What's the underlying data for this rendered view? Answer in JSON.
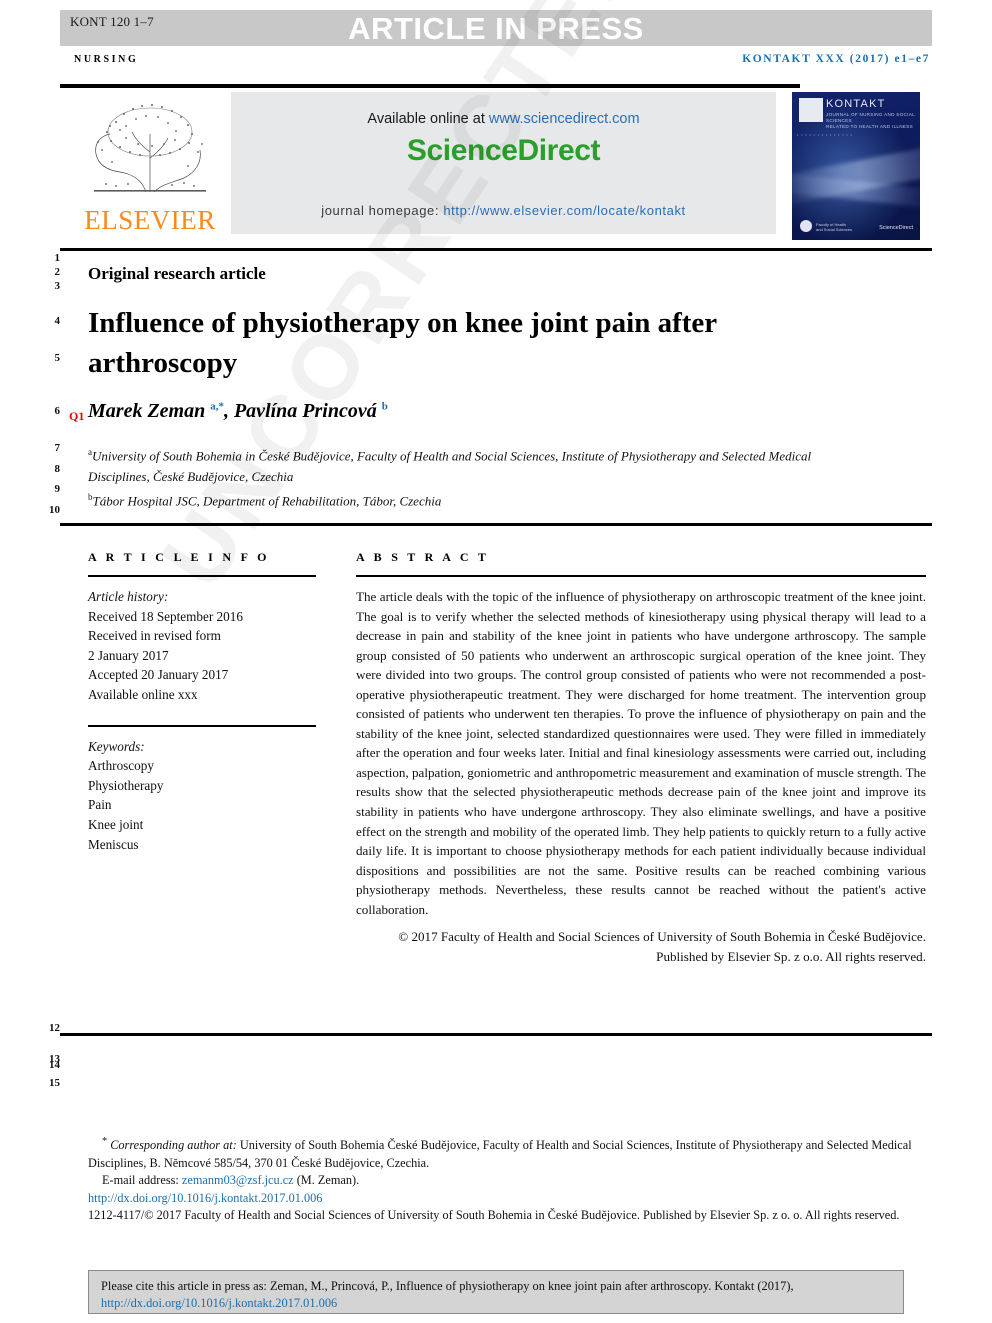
{
  "banner": {
    "code": "KONT 120 1–7",
    "text": "ARTICLE IN PRESS"
  },
  "running_head": {
    "left": "NURSING",
    "right": "KONTAKT XXX (2017) e1–e7"
  },
  "masthead": {
    "elsevier_wordmark": "ELSEVIER",
    "available_prefix": "Available online at ",
    "available_url": "www.sciencedirect.com",
    "brand": "ScienceDirect",
    "homepage_prefix": "journal homepage: ",
    "homepage_url": "http://www.elsevier.com/locate/kontakt",
    "cover": {
      "title": "KONTAKT",
      "subtitle": "JOURNAL OF NURSING AND SOCIAL SCIENCES\nRELATED TO HEALTH AND ILLNESS",
      "strip": "•  •  •  •  •  •  •  •  •  •  •  •  •  •",
      "footer_text": "Faculty of Health\nand Social Sciences",
      "footer_brand": "ScienceDirect"
    }
  },
  "line_numbers": {
    "top": [
      "1",
      "2",
      "3",
      "4",
      "5",
      "6",
      "7",
      "8",
      "9",
      "10"
    ],
    "bottom": [
      "12",
      "13",
      "14",
      "15"
    ]
  },
  "article": {
    "kicker": "Original research article",
    "title": "Influence of physiotherapy on knee joint pain after arthroscopy",
    "query_marker": "Q1",
    "authors_html": "Marek Zeman <sup>a,*</sup>, Pavlína Princová <sup>b</sup>",
    "affiliations": [
      "University of South Bohemia in České Budějovice, Faculty of Health and Social Sciences, Institute of Physiotherapy and Selected Medical Disciplines, České Budějovice, Czechia",
      "Tábor Hospital JSC, Department of Rehabilitation, Tábor, Czechia"
    ]
  },
  "article_info": {
    "heading": "A R T I C L E   I N F O",
    "history_label": "Article history:",
    "history": [
      "Received 18 September 2016",
      "Received in revised form",
      "2 January 2017",
      "Accepted 20 January 2017",
      "Available online xxx"
    ],
    "keywords_label": "Keywords:",
    "keywords": [
      "Arthroscopy",
      "Physiotherapy",
      "Pain",
      "Knee joint",
      "Meniscus"
    ]
  },
  "abstract": {
    "heading": "A B S T R A C T",
    "body": "The article deals with the topic of the influence of physiotherapy on arthroscopic treatment of the knee joint. The goal is to verify whether the selected methods of kinesiotherapy using physical therapy will lead to a decrease in pain and stability of the knee joint in patients who have undergone arthroscopy. The sample group consisted of 50 patients who underwent an arthroscopic surgical operation of the knee joint. They were divided into two groups. The control group consisted of patients who were not recommended a post-operative physiotherapeutic treatment. They were discharged for home treatment. The intervention group consisted of patients who underwent ten therapies. To prove the influence of physiotherapy on pain and the stability of the knee joint, selected standardized questionnaires were used. They were filled in immediately after the operation and four weeks later. Initial and final kinesiology assessments were carried out, including aspection, palpation, goniometric and anthropometric measurement and examination of muscle strength. The results show that the selected physiotherapeutic methods decrease pain of the knee joint and improve its stability in patients who have undergone arthroscopy. They also eliminate swellings, and have a positive effect on the strength and mobility of the operated limb. They help patients to quickly return to a fully active daily life. It is important to choose physiotherapy methods for each patient individually because individual dispositions and possibilities are not the same. Positive results can be reached combining various physiotherapy methods. Nevertheless, these results cannot be reached without the patient's active collaboration.",
    "copyright": "© 2017 Faculty of Health and Social Sciences of University of South Bohemia in České Budějovice. Published by Elsevier Sp. z o.o. All rights reserved."
  },
  "footnotes": {
    "corresponding_label": "Corresponding author at:",
    "corresponding_text": " University of South Bohemia České Budějovice, Faculty of Health and Social Sciences, Institute of Physiotherapy and Selected Medical Disciplines, B. Němcové 585/54, 370 01 České Budějovice, Czechia.",
    "email_label": "E-mail address:",
    "email": "zemanm03@zsf.jcu.cz",
    "email_suffix": " (M. Zeman).",
    "doi_url": "http://dx.doi.org/10.1016/j.kontakt.2017.01.006",
    "issn_line": "1212-4117/© 2017 Faculty of Health and Social Sciences of University of South Bohemia in České Budějovice. Published by Elsevier Sp. z o. o. All rights reserved."
  },
  "cite_box": {
    "text": "Please cite this article in press as: Zeman, M., Princová, P., Influence of physiotherapy on knee joint pain after arthroscopy. Kontakt (2017),",
    "url": "http://dx.doi.org/10.1016/j.kontakt.2017.01.006"
  },
  "watermark": {
    "text": "UNCORRECTED PROOF"
  },
  "colors": {
    "banner_bg": "#c8c8c8",
    "link": "#1a6faf",
    "sciencedirect_green": "#2aa02a",
    "elsevier_orange": "#f68a1e",
    "query_red": "#e00000",
    "cite_bg": "#d4d4d4"
  }
}
